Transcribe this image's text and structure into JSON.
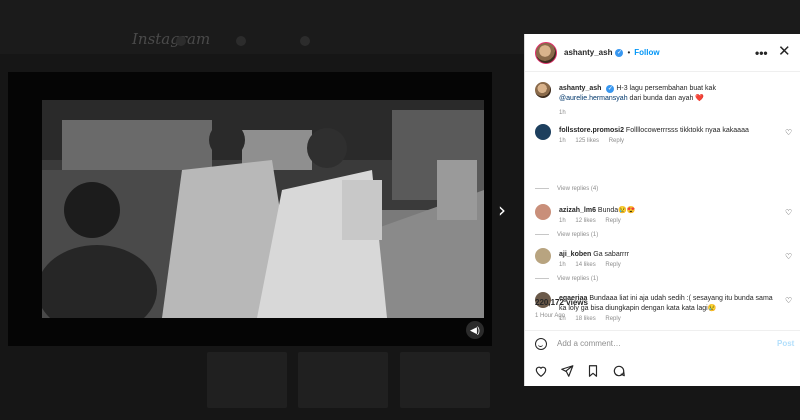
{
  "background": {
    "logo": "Instagram"
  },
  "post": {
    "username": "ashanty_ash",
    "separator": "•",
    "follow_label": "Follow",
    "more_icon": "more-horizontal-icon",
    "close_icon": "close-icon"
  },
  "caption": {
    "username": "ashanty_ash",
    "text_before": "H-3 lagu persembahan buat kak",
    "mention": "@aurelie.hermansyah",
    "text_after": "dari bunda dan ayah",
    "emoji": "❤️",
    "time": "1h"
  },
  "comments": [
    {
      "username": "follsstore.promosi2",
      "text": "Follllocowerrrsss tikktokk nyaa kakaaaa",
      "time": "1h",
      "likes": "125 likes",
      "reply": "Reply",
      "view_replies": "View replies (4)"
    },
    {
      "username": "azizah_lm6",
      "text": "Bunda😢😍",
      "time": "1h",
      "likes": "12 likes",
      "reply": "Reply",
      "view_replies": ""
    },
    {
      "username": "aji_koben",
      "text": "Ga sabarrrr",
      "time": "1h",
      "likes": "14 likes",
      "reply": "Reply",
      "view_replies": "View replies (1)"
    },
    {
      "username": "egaeriaa",
      "text": "Bundaaa liat ini aja udah sedih :( sesayang itu bunda sama ka loly ga bisa diungkapin dengan kata kata lagi😢",
      "time": "1h",
      "likes": "18 likes",
      "reply": "Reply",
      "view_replies": ""
    }
  ],
  "extra_view_replies": "View replies (1)",
  "stats": {
    "views": "220,172 views",
    "posted": "1 Hour Ago"
  },
  "add_comment": {
    "placeholder": "Add a comment…",
    "post_label": "Post"
  },
  "actions": [
    "heart-icon",
    "comment-icon",
    "share-icon",
    "bookmark-icon"
  ],
  "colors": {
    "accent": "#0095f6",
    "post_disabled": "#b2dffc",
    "overlay": "#0c0c0c"
  }
}
